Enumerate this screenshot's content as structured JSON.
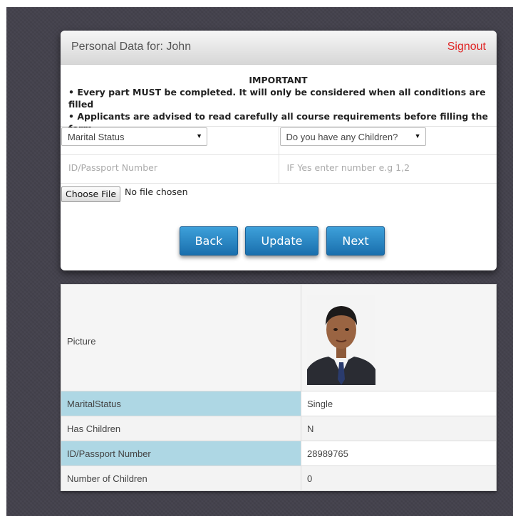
{
  "header": {
    "title": "Personal Data for: John",
    "signout_label": "Signout"
  },
  "notice": {
    "title": "IMPORTANT",
    "items": [
      "Every part MUST be completed. It will only be considered when all conditions are filled",
      "Applicants are advised to read carefully all course requirements before filling the form."
    ]
  },
  "form": {
    "marital_status": {
      "selected": "Marital Status"
    },
    "children": {
      "selected": "Do you have any Children?"
    },
    "id_passport": {
      "placeholder": "ID/Passport Number",
      "value": ""
    },
    "children_count": {
      "placeholder": "IF Yes enter number e.g 1,2",
      "value": ""
    },
    "file": {
      "button_label": "Choose File",
      "status": "No file chosen"
    },
    "buttons": {
      "back": "Back",
      "update": "Update",
      "next": "Next"
    }
  },
  "summary": {
    "picture_label": "Picture",
    "rows": [
      {
        "label": "MaritalStatus",
        "value": "Single"
      },
      {
        "label": "Has Children",
        "value": "N"
      },
      {
        "label": "ID/Passport Number",
        "value": "28989765"
      },
      {
        "label": "Number of Children",
        "value": "0"
      }
    ]
  },
  "colors": {
    "accent_button": "#2a85c6",
    "signout": "#e02424",
    "highlight_row": "#aed7e4",
    "background": "#44424d"
  }
}
